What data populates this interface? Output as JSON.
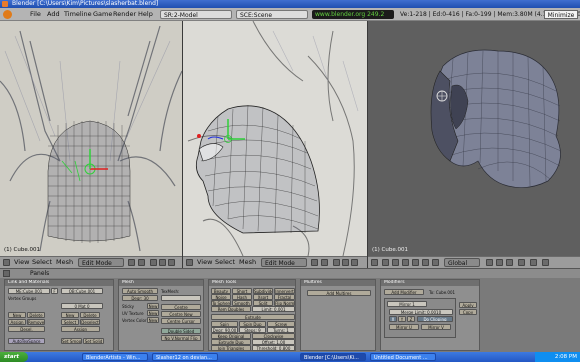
{
  "window": {
    "title": "Blender [C:\\Users\\Kim\\Pictures\\slasherbat.blend]"
  },
  "menu": {
    "items": [
      "File",
      "Add",
      "Timeline",
      "Game",
      "Render",
      "Help"
    ],
    "screen_field": "SR:2-Model",
    "scene_field": "SCE:Scene",
    "url": "www.blender.org 249.2",
    "stats": "Ve:1-218 | Ed:0-416 | Fa:0-199 | Mem:3.80M (4.14M) Cube.001",
    "minimize": "Minimize"
  },
  "viewports": {
    "left_label": "(1) Cube.001",
    "mid_label": "",
    "right_label": "(1) Cube.001"
  },
  "headers": {
    "view": "View",
    "select": "Select",
    "mesh": "Mesh",
    "mode": "Edit Mode",
    "orientation": "Global"
  },
  "panels": {
    "title": "Panels",
    "link_materials": {
      "head": "Link and Materials",
      "me": "ME:Cube.001",
      "f": "F",
      "ob": "OB:Cube.001",
      "vertex_groups": "Vertex Groups",
      "mat": "0 Mat 0",
      "buttons": [
        "New",
        "Delete",
        "New",
        "Delete",
        "Assign",
        "Remove",
        "Select",
        "Deselect",
        "Desel.",
        "Assign"
      ],
      "autotex": "AutoTexSpace",
      "set_smooth": "Set Smooth",
      "set_solid": "Set Solid"
    },
    "mesh": {
      "head": "Mesh",
      "auto_smooth": "Auto Smooth",
      "degr": "Degr: 30",
      "sticky": "Sticky",
      "uv_textures": "UV Texture",
      "vertex_color": "Vertex Color",
      "texmesh": "TexMesh:",
      "center": "Centre",
      "center_new": "Centre New",
      "center_cursor": "Centre Cursor",
      "double_sided": "Double Sided",
      "no_vnormal": "No V.Normal Flip",
      "new": "New"
    },
    "multires": {
      "head": "Multires",
      "add": "Add Multires"
    },
    "mesh_tools": {
      "head": "Mesh Tools",
      "row1": [
        "Beauty",
        "Short",
        "Subdivide",
        "Innervert"
      ],
      "row2": [
        "Noise",
        "Hash",
        "Xsort",
        "Fractal"
      ],
      "row3": [
        "To Sphere",
        "Smooth",
        "Split",
        "Flip Normal"
      ],
      "rem_doubles": "Rem Doubles",
      "limit": "Limit: 0.001",
      "extrude": "Extrude",
      "spin": "Spin",
      "spin_dup": "Spin Dup",
      "screw": "Screw",
      "degr": "Degr: 90.00",
      "steps": "Steps: 9",
      "turns": "Turns: 1",
      "keep_orig": "Keep Original",
      "clockwise": "Clockwise",
      "extrude_dup": "Extrude Dup",
      "offset": "Offset: 1.00",
      "join_triangles": "Join Triangles",
      "threshold": "Threshold: 0.800"
    },
    "modifiers": {
      "head": "Modifiers",
      "add": "Add Modifier",
      "to": "To: Cube.001",
      "mirror": "Mirror 1",
      "merge_limit": "Merge Limit: 0.0010",
      "x": "X",
      "y": "Y",
      "z": "Z",
      "do_clipping": "Do Clipping",
      "mirror_u": "Mirror U",
      "mirror_v": "Mirror V",
      "apply": "Apply",
      "copy": "Copy"
    }
  },
  "taskbar": {
    "start": "start",
    "tasks": [
      "BlenderArtists - Win...",
      "Slasher12 on devian...",
      "Blender [C:\\Users\\Ki...",
      "Untitled Document ..."
    ],
    "clock": "2:08 PM"
  },
  "colors": {
    "title_bar": "#2f5fc8",
    "url_text": "#62d13f",
    "selection_green": "#2fd03a",
    "gizmo_red": "#e02020",
    "gizmo_blue": "#2030e0",
    "mesh_solid": "#7d8297",
    "panel_bg": "#8f8f8f"
  }
}
